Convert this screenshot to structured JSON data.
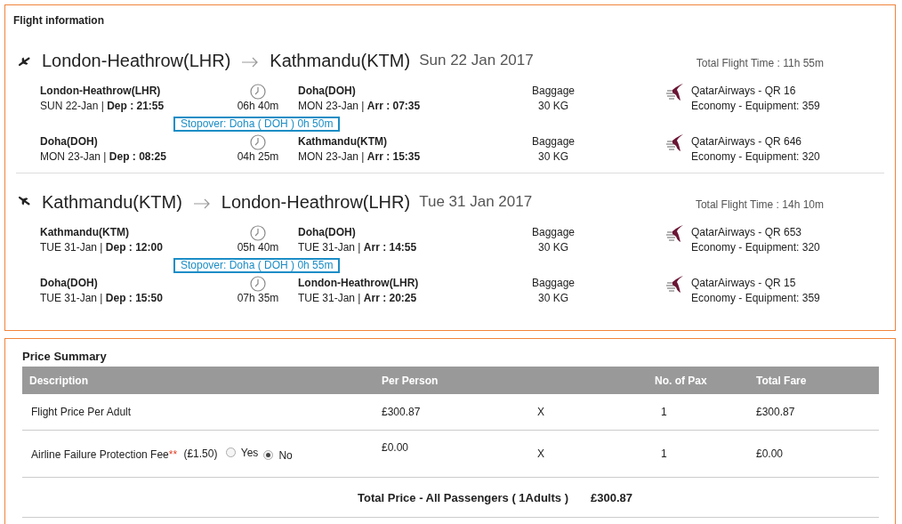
{
  "flight_info": {
    "title": "Flight information",
    "journeys": [
      {
        "kind": "outbound",
        "from": "London-Heathrow(LHR)",
        "to": "Kathmandu(KTM)",
        "date": "Sun 22 Jan 2017",
        "total_time": "Total Flight Time : 11h 55m",
        "items": [
          {
            "kind": "segment",
            "dep_airport": "London-Heathrow(LHR)",
            "dep_line": "SUN 22-Jan | **Dep : 21:55**",
            "duration": "06h 40m",
            "arr_airport": "Doha(DOH)",
            "arr_line": "MON 23-Jan | **Arr : 07:35**",
            "baggage_label": "Baggage",
            "baggage": "30 KG",
            "airline": "QatarAirways - QR 16",
            "cabin": "Economy - Equipment: 359"
          },
          {
            "kind": "stopover",
            "text": "Stopover: Doha ( DOH ) 0h 50m"
          },
          {
            "kind": "segment",
            "dep_airport": "Doha(DOH)",
            "dep_line": "MON 23-Jan | **Dep : 08:25**",
            "duration": "04h 25m",
            "arr_airport": "Kathmandu(KTM)",
            "arr_line": "MON 23-Jan | **Arr : 15:35**",
            "baggage_label": "Baggage",
            "baggage": "30 KG",
            "airline": "QatarAirways - QR 646",
            "cabin": "Economy - Equipment: 320"
          }
        ]
      },
      {
        "kind": "return",
        "from": "Kathmandu(KTM)",
        "to": "London-Heathrow(LHR)",
        "date": "Tue 31 Jan 2017",
        "total_time": "Total Flight Time : 14h 10m",
        "items": [
          {
            "kind": "segment",
            "dep_airport": "Kathmandu(KTM)",
            "dep_line": "TUE 31-Jan | **Dep : 12:00**",
            "duration": "05h 40m",
            "arr_airport": "Doha(DOH)",
            "arr_line": "TUE 31-Jan | **Arr : 14:55**",
            "baggage_label": "Baggage",
            "baggage": "30 KG",
            "airline": "QatarAirways - QR 653",
            "cabin": "Economy - Equipment: 320"
          },
          {
            "kind": "stopover",
            "text": "Stopover: Doha ( DOH ) 0h 55m"
          },
          {
            "kind": "segment",
            "dep_airport": "Doha(DOH)",
            "dep_line": "TUE 31-Jan | **Dep : 15:50**",
            "duration": "07h 35m",
            "arr_airport": "London-Heathrow(LHR)",
            "arr_line": "TUE 31-Jan | **Arr : 20:25**",
            "baggage_label": "Baggage",
            "baggage": "30 KG",
            "airline": "QatarAirways - QR 15",
            "cabin": "Economy - Equipment: 359"
          }
        ]
      }
    ]
  },
  "price_summary": {
    "title": "Price Summary",
    "columns": [
      "Description",
      "Per Person",
      "No. of Pax",
      "Total Fare"
    ],
    "rows": [
      {
        "kind": "plain",
        "description": "Flight Price Per Adult",
        "per_person": "£300.87",
        "times": "X",
        "pax": "1",
        "total": "£300.87"
      },
      {
        "kind": "optional",
        "description": "Airline Failure Protection Fee",
        "mark": "**",
        "fee": "(£1.50)",
        "options": [
          {
            "label": "Yes",
            "selected": false
          },
          {
            "label": "No",
            "selected": true
          }
        ],
        "per_person": "£0.00",
        "times": "X",
        "pax": "1",
        "total": "£0.00"
      }
    ],
    "total_label": "Total Price - All Passengers ( 1Adults )",
    "total_value": "£300.87"
  }
}
